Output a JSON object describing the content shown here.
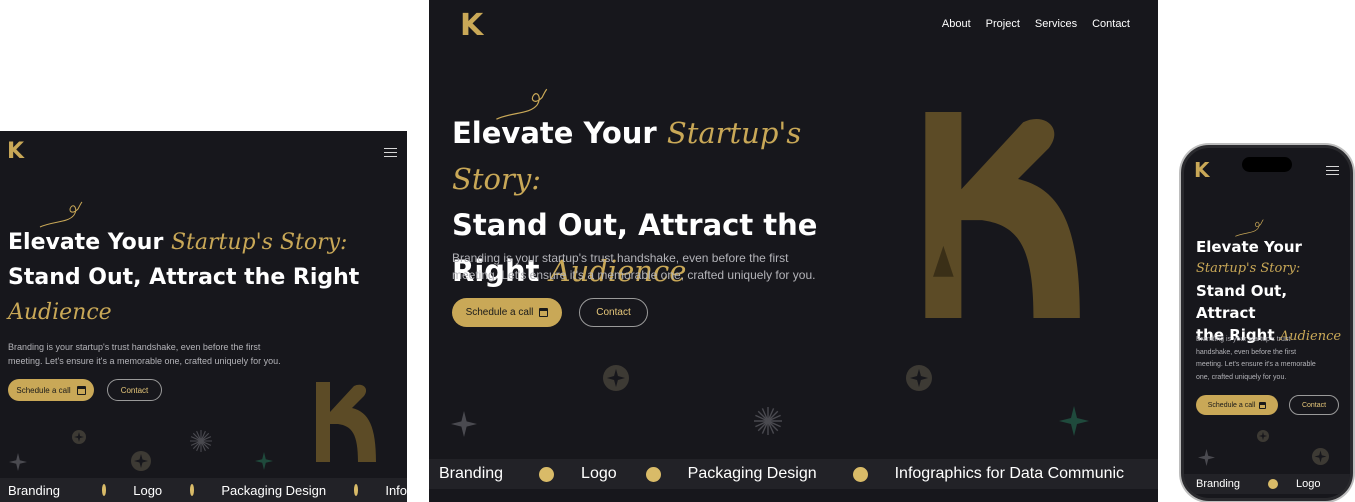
{
  "brand": {
    "logo_text": "K",
    "accent": "#c9a857",
    "background": "#17171c"
  },
  "nav": {
    "items": [
      "About",
      "Project",
      "Services",
      "Contact"
    ]
  },
  "hero": {
    "line1_text": "Elevate Your",
    "line1_script": "Startup's Story:",
    "line2_text": "Stand Out, Attract the",
    "line3_text": "Right",
    "line3_script": "Audience",
    "tablet_line2": "Stand Out, Attract the Right",
    "phone_line3": "Stand Out, Attract",
    "phone_line4": "the Right",
    "paragraph_a": "Branding is your startup's trust handshake, even before the first",
    "paragraph_b": "meeting. Let's ensure it's a memorable one, crafted uniquely for you.",
    "phone_p1": "Branding is your startup's trust",
    "phone_p2": "handshake, even before the first",
    "phone_p3": "meeting. Let's ensure it's a memorable",
    "phone_p4": "one, crafted uniquely for you.",
    "cta_primary": "Schedule a call",
    "cta_secondary": "Contact"
  },
  "ticker": {
    "items": [
      "Branding",
      "Logo",
      "Packaging Design",
      "Infographics for Data Communic"
    ],
    "tablet_cut": "Info",
    "dot_color": "#d9bb68"
  },
  "icons": {
    "menu": "hamburger-icon",
    "calendar": "calendar-icon",
    "sparkle": "star-sparkle-icon"
  }
}
